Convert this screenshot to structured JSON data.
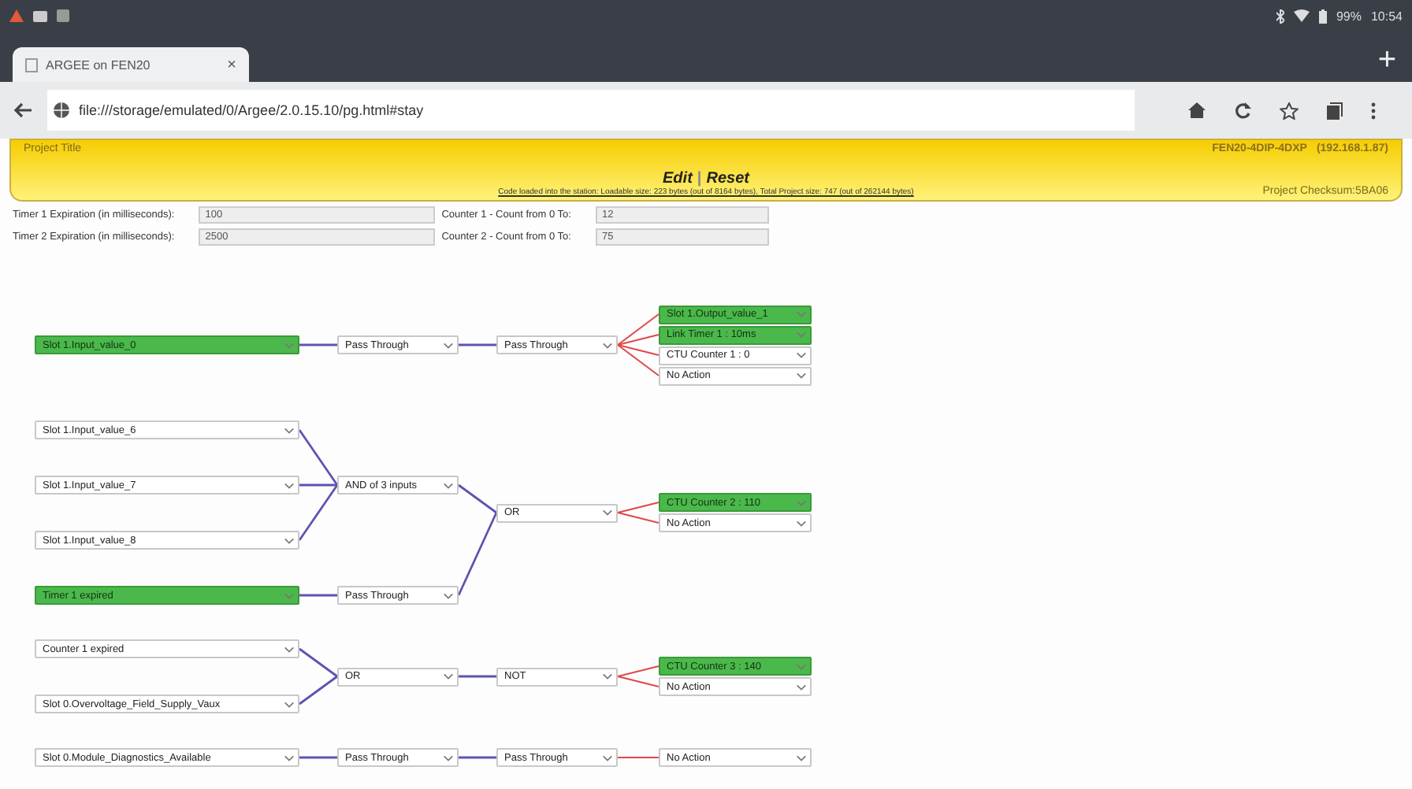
{
  "status_bar": {
    "battery": "99%",
    "time": "10:54"
  },
  "browser": {
    "tab": {
      "title": "ARGEE on FEN20",
      "close": "×"
    },
    "new_tab": "+",
    "url": "file:///storage/emulated/0/Argee/2.0.15.10/pg.html#stay"
  },
  "header": {
    "project_title": "Project Title",
    "edit": "Edit",
    "separator": "|",
    "reset": "Reset",
    "device": "FEN20-4DIP-4DXP",
    "ip": "(192.168.1.87)",
    "checksum": "Project Checksum:5BA06",
    "load_info": "Code loaded into the station: Loadable size: 223 bytes (out of 8164 bytes), Total Project size: 747 (out of 262144 bytes)"
  },
  "settings": [
    {
      "label": "Timer 1 Expiration (in milliseconds):",
      "value": "100"
    },
    {
      "label": "Counter 1 - Count from 0 To:",
      "value": "12"
    },
    {
      "label": "Timer 2 Expiration (in milliseconds):",
      "value": "2500"
    },
    {
      "label": "Counter 2 - Count from 0 To:",
      "value": "75"
    }
  ],
  "chains": [
    {
      "root": {
        "kind": "gate",
        "label": "Pass Through",
        "inputs": [
          {
            "kind": "gate",
            "label": "Pass Through",
            "inputs": [
              {
                "kind": "signal",
                "label": "Slot 1.Input_value_0",
                "active": true
              }
            ]
          }
        ]
      },
      "outputs": [
        {
          "label": "Slot 1.Output_value_1",
          "active": true
        },
        {
          "label": "Link Timer 1 : 10ms",
          "active": true
        },
        {
          "label": "CTU Counter 1 : 0",
          "active": false
        },
        {
          "label": "No Action",
          "active": false
        }
      ]
    },
    {
      "root": {
        "kind": "gate",
        "label": "OR",
        "inputs": [
          {
            "kind": "gate",
            "label": "AND of 3 inputs",
            "inputs": [
              {
                "kind": "signal",
                "label": "Slot 1.Input_value_6",
                "active": false
              },
              {
                "kind": "signal",
                "label": "Slot 1.Input_value_7",
                "active": false
              },
              {
                "kind": "signal",
                "label": "Slot 1.Input_value_8",
                "active": false
              }
            ]
          },
          {
            "kind": "gate",
            "label": "Pass Through",
            "inputs": [
              {
                "kind": "signal",
                "label": "Timer 1 expired",
                "active": true
              }
            ]
          }
        ]
      },
      "outputs": [
        {
          "label": "CTU Counter 2 : 110",
          "active": true
        },
        {
          "label": "No Action",
          "active": false
        }
      ]
    },
    {
      "root": {
        "kind": "gate",
        "label": "NOT",
        "inputs": [
          {
            "kind": "gate",
            "label": "OR",
            "inputs": [
              {
                "kind": "signal",
                "label": "Counter 1 expired",
                "active": false
              },
              {
                "kind": "signal",
                "label": "Slot 0.Overvoltage_Field_Supply_Vaux",
                "active": false
              }
            ]
          }
        ]
      },
      "outputs": [
        {
          "label": "CTU Counter 3 : 140",
          "active": true
        },
        {
          "label": "No Action",
          "active": false
        }
      ]
    },
    {
      "root": {
        "kind": "gate",
        "label": "Pass Through",
        "inputs": [
          {
            "kind": "gate",
            "label": "Pass Through",
            "inputs": [
              {
                "kind": "signal",
                "label": "Slot 0.Module_Diagnostics_Available",
                "active": false
              }
            ]
          }
        ]
      },
      "outputs": [
        {
          "label": "No Action",
          "active": false
        }
      ]
    }
  ]
}
